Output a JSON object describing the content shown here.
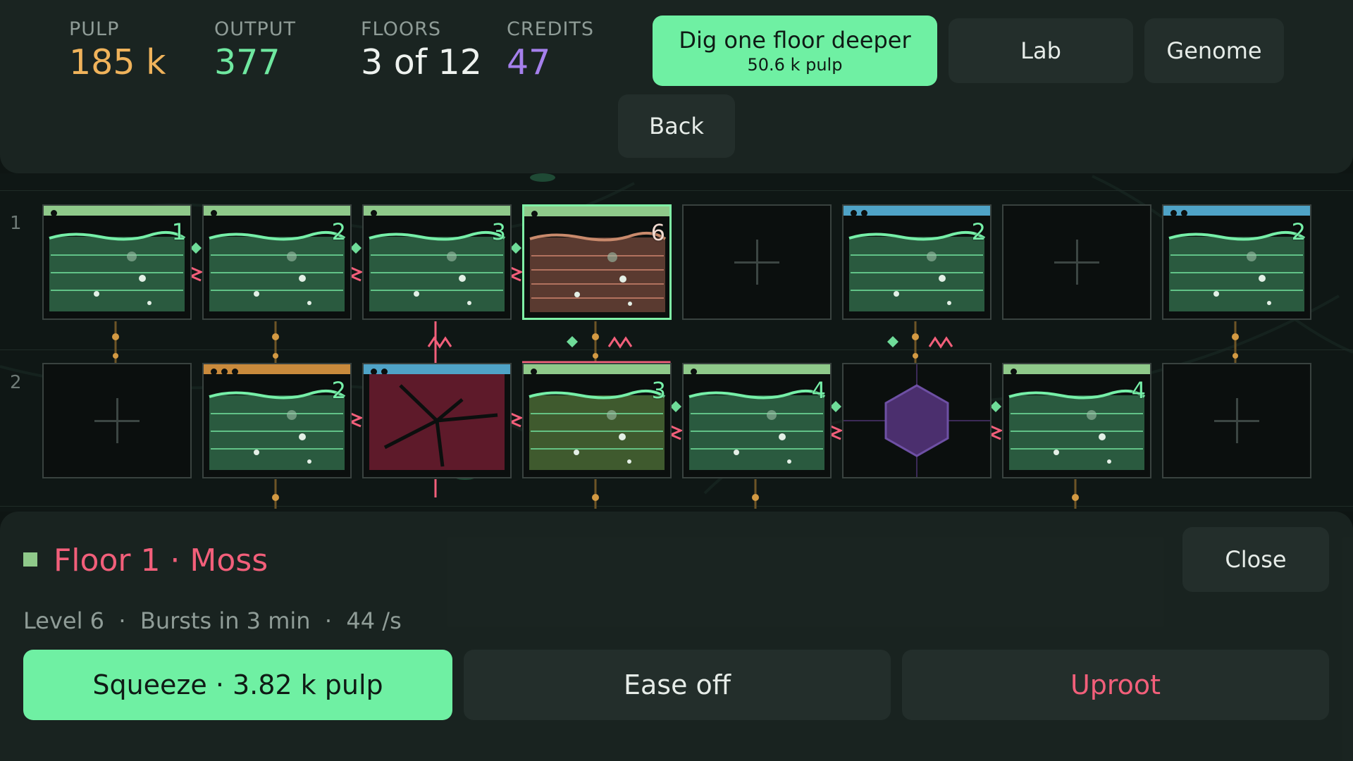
{
  "stats": {
    "pulp": {
      "label": "PULP",
      "value": "185 k"
    },
    "output": {
      "label": "OUTPUT",
      "value": "377"
    },
    "floors": {
      "label": "FLOORS",
      "value": "3 of 12"
    },
    "credits": {
      "label": "CREDITS",
      "value": "47"
    }
  },
  "actions": {
    "dig_label": "Dig one floor deeper",
    "dig_cost": "50.6 k pulp",
    "lab": "Lab",
    "genome": "Genome",
    "back": "Back"
  },
  "colors": {
    "accent": "#6ff0a3",
    "pulp": "#f0b35b",
    "credits": "#a580ec",
    "danger": "#f25f7a",
    "moss": "#8fc98a",
    "water": "#4fa3c7",
    "amber": "#c98a3c",
    "rot": "#5e1a2a",
    "void": "#4b2f6e"
  },
  "grid": {
    "row_labels": [
      "1",
      "2"
    ],
    "rows": [
      [
        {
          "kind": "plant",
          "cap": "moss",
          "dots": 1,
          "level": "1"
        },
        {
          "kind": "plant",
          "cap": "moss",
          "dots": 1,
          "level": "2"
        },
        {
          "kind": "plant",
          "cap": "moss",
          "dots": 1,
          "level": "3"
        },
        {
          "kind": "plant",
          "cap": "moss",
          "dots": 1,
          "level": "6",
          "variant": "soil",
          "selected": true
        },
        {
          "kind": "empty"
        },
        {
          "kind": "plant",
          "cap": "water",
          "dots": 2,
          "level": "2"
        },
        {
          "kind": "empty"
        },
        {
          "kind": "plant",
          "cap": "water",
          "dots": 2,
          "level": "2"
        }
      ],
      [
        {
          "kind": "empty"
        },
        {
          "kind": "plant",
          "cap": "amber",
          "dots": 3,
          "level": "2"
        },
        {
          "kind": "rot",
          "cap": "water",
          "dots": 2
        },
        {
          "kind": "plant",
          "cap": "moss",
          "dots": 1,
          "level": "3",
          "variant": "olive"
        },
        {
          "kind": "plant",
          "cap": "moss",
          "dots": 1,
          "level": "4"
        },
        {
          "kind": "void"
        },
        {
          "kind": "plant",
          "cap": "moss",
          "dots": 1,
          "level": "4"
        },
        {
          "kind": "empty"
        }
      ]
    ]
  },
  "detail": {
    "title": "Floor 1 · Moss",
    "meta": "Level 6  ·  Bursts in 3 min  ·  44 /s",
    "close": "Close",
    "squeeze": "Squeeze · 3.82 k pulp",
    "ease": "Ease off",
    "uproot": "Uproot"
  }
}
